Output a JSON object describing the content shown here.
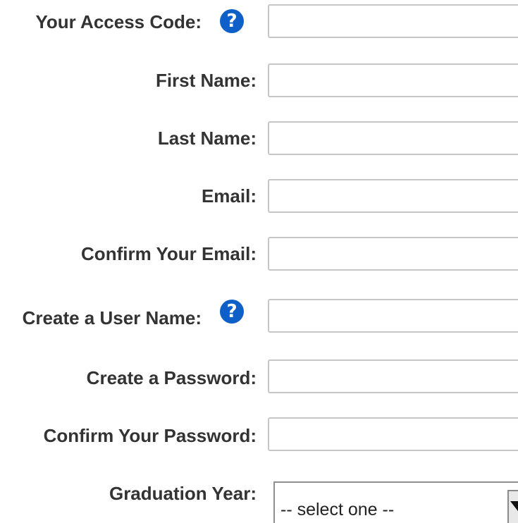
{
  "form": {
    "help_glyph": "?",
    "help_color": "#0f5fc9",
    "label_color": "#333333",
    "fields": [
      {
        "label": "Your Access Code:",
        "value": "",
        "has_help": true
      },
      {
        "label": "First Name:",
        "value": ""
      },
      {
        "label": "Last Name:",
        "value": ""
      },
      {
        "label": "Email:",
        "value": ""
      },
      {
        "label": "Confirm Your Email:",
        "value": ""
      },
      {
        "label": "Create a User Name:",
        "value": "",
        "has_help": true
      },
      {
        "label": "Create a Password:",
        "value": ""
      },
      {
        "label": "Confirm Your Password:",
        "value": ""
      }
    ],
    "graduation": {
      "label": "Graduation Year:",
      "selected": "-- select one --"
    }
  }
}
